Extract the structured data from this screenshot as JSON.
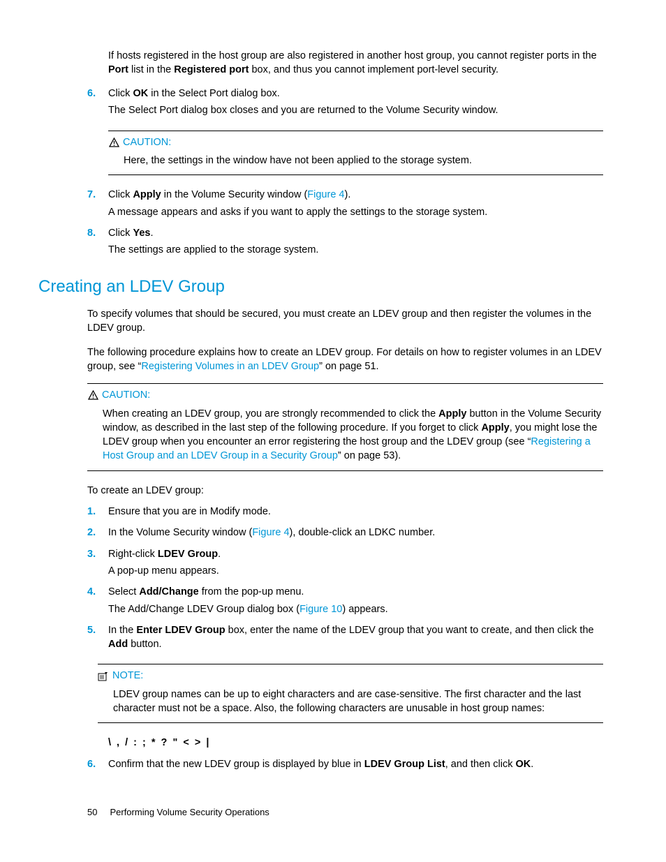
{
  "intro_para": {
    "t1": "If hosts registered in the host group are also registered in another host group, you cannot register ports in the ",
    "b1": "Port",
    "t2": " list in the ",
    "b2": "Registered port",
    "t3": " box, and thus you cannot implement port-level security."
  },
  "steps_a": {
    "s6": {
      "num": "6.",
      "l1a": "Click ",
      "l1b": "OK",
      "l1c": " in the Select Port dialog box.",
      "l2": "The Select Port dialog box closes and you are returned to the Volume Security window."
    },
    "s7": {
      "num": "7.",
      "l1a": "Click ",
      "l1b": "Apply",
      "l1c": " in the Volume Security window (",
      "link": "Figure 4",
      "l1d": ").",
      "l2": "A message appears and asks if you want to apply the settings to the storage system."
    },
    "s8": {
      "num": "8.",
      "l1a": "Click ",
      "l1b": "Yes",
      "l1c": ".",
      "l2": "The settings are applied to the storage system."
    }
  },
  "caution1": {
    "label": "CAUTION:",
    "body": "Here, the settings in the window have not been applied to the storage system."
  },
  "h2": "Creating an LDEV Group",
  "sec_p1": "To specify volumes that should be secured, you must create an LDEV group and then register the volumes in the LDEV group.",
  "sec_p2": {
    "t1": "The following procedure explains how to create an LDEV group. For details on how to register volumes in an LDEV group, see “",
    "link": "Registering Volumes in an LDEV Group",
    "t2": "” on page 51."
  },
  "caution2": {
    "label": "CAUTION:",
    "t1": "When creating an LDEV group, you are strongly recommended to click the ",
    "b1": "Apply",
    "t2": " button in the Volume Security window, as described in the last step of the following procedure. If you forget to click ",
    "b2": "Apply",
    "t3": ", you might lose the LDEV group when you encounter an error registering the host group and the LDEV group (see “",
    "link": "Registering a Host Group and an LDEV Group in a Security Group",
    "t4": "” on page 53)."
  },
  "lead": "To create an LDEV group:",
  "steps_b": {
    "s1": {
      "num": "1.",
      "l1": "Ensure that you are in Modify mode."
    },
    "s2": {
      "num": "2.",
      "l1a": "In the Volume Security window (",
      "link": "Figure 4",
      "l1b": "), double-click an LDKC number."
    },
    "s3": {
      "num": "3.",
      "l1a": "Right-click ",
      "l1b": "LDEV Group",
      "l1c": ".",
      "l2": "A pop-up menu appears."
    },
    "s4": {
      "num": "4.",
      "l1a": "Select ",
      "l1b": "Add/Change",
      "l1c": " from the pop-up menu.",
      "l2a": "The Add/Change LDEV Group dialog box (",
      "link": "Figure 10",
      "l2b": ") appears."
    },
    "s5": {
      "num": "5.",
      "l1a": "In the ",
      "l1b": "Enter LDEV Group",
      "l1c": " box, enter the name of the LDEV group that you want to create, and then click the ",
      "l1d": "Add",
      "l1e": " button."
    },
    "s6": {
      "num": "6.",
      "l1a": "Confirm that the new LDEV group is displayed by blue in ",
      "l1b": "LDEV Group List",
      "l1c": ", and then click ",
      "l1d": "OK",
      "l1e": "."
    }
  },
  "note": {
    "label": "NOTE:",
    "body": "LDEV group names can be up to eight characters and are case-sensitive. The first character and the last character must not be a space. Also, the following characters are unusable in host group names:"
  },
  "chars": "\\ , / : ; * ? \" < > |",
  "footer": {
    "page": "50",
    "title": "Performing Volume Security Operations"
  }
}
